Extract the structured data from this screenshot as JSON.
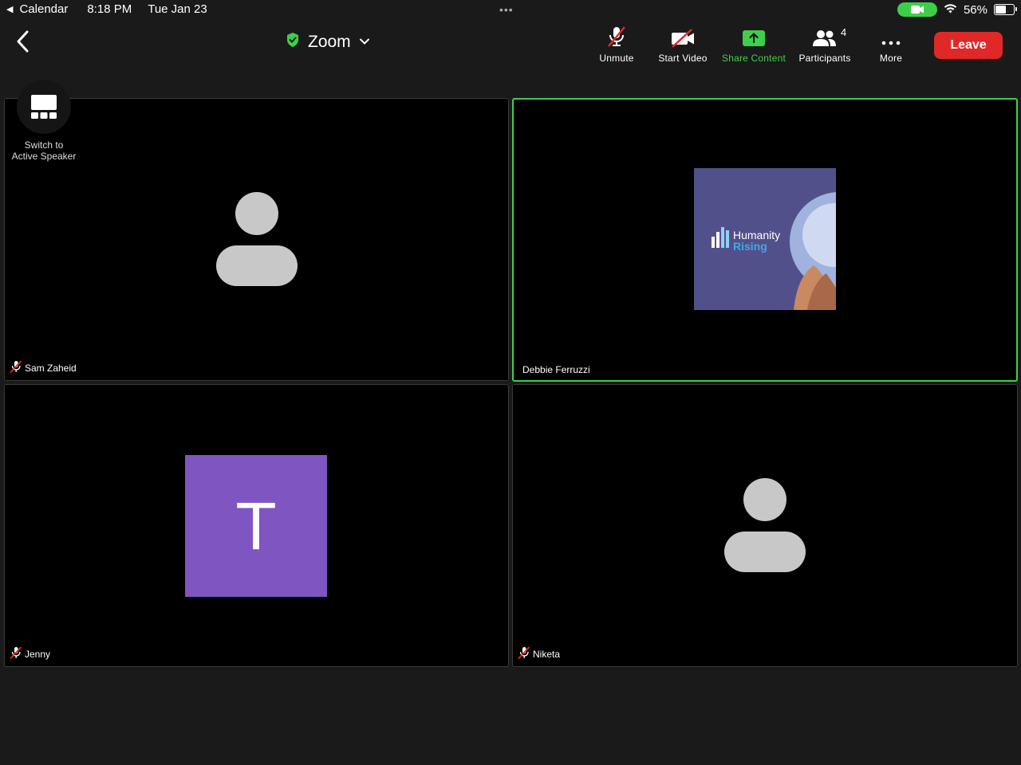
{
  "status_bar": {
    "back_app": "Calendar",
    "time": "8:18 PM",
    "date": "Tue Jan 23",
    "battery": "56%",
    "battery_level": 0.56,
    "center_indicator": "•••"
  },
  "toolbar": {
    "title": "Zoom",
    "unmute_label": "Unmute",
    "start_video_label": "Start Video",
    "share_label": "Share Content",
    "participants_label": "Participants",
    "participants_count": "4",
    "more_label": "More",
    "leave_label": "Leave"
  },
  "switch_speaker": {
    "line1": "Switch to",
    "line2": "Active Speaker"
  },
  "tiles": [
    {
      "name": "Sam Zaheid",
      "muted": true,
      "avatar": "person-silhouette"
    },
    {
      "name": "Debbie Ferruzzi",
      "muted": false,
      "avatar": "profile-image",
      "active": true,
      "image_text_1": "Humanity",
      "image_text_2": "Rising"
    },
    {
      "name": "Jenny",
      "muted": true,
      "avatar": "letter",
      "letter": "T"
    },
    {
      "name": "Niketa",
      "muted": true,
      "avatar": "person-silhouette"
    }
  ],
  "colors": {
    "background": "#1a1a1a",
    "accent_green": "#3ecf4a",
    "leave_red": "#e02828",
    "letter_avatar": "#7e55c1",
    "muted_icon": "#e02828"
  }
}
